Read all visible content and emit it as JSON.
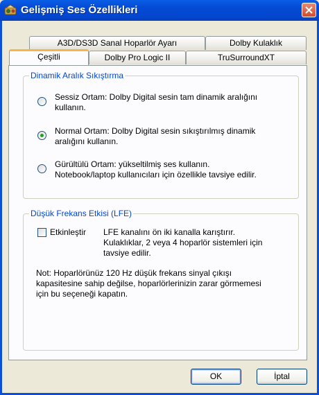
{
  "window": {
    "title": "Gelişmiş Ses Özellikleri"
  },
  "tabs": {
    "row_back": [
      "A3D/DS3D Sanal Hoparlör Ayarı",
      "Dolby Kulaklık"
    ],
    "row_front": [
      "Çeşitli",
      "Dolby Pro Logic II",
      "TruSurroundXT"
    ],
    "active": "Çeşitli"
  },
  "drc": {
    "legend": "Dinamik Aralık Sıkıştırma",
    "options": [
      {
        "line1": "Sessiz Ortam: Dolby Digital sesin tam dinamik aralığını",
        "line2": "kullanın.",
        "selected": false
      },
      {
        "line1": "Normal Ortam: Dolby Digital sesin sıkıştırılmış dinamik",
        "line2": "aralığını kullanın.",
        "selected": true
      },
      {
        "line1": "Gürültülü Ortam: yükseltilmiş ses kullanın.",
        "line2": "Notebook/laptop kullanıcıları için özellikle tavsiye edilir.",
        "selected": false
      }
    ]
  },
  "lfe": {
    "legend": "Düşük Frekans Etkisi (LFE)",
    "checkbox_label": "Etkinleştir",
    "checked": false,
    "desc1": "LFE kanalını ön iki kanalla karıştırır.",
    "desc2": "Kulaklıklar, 2 veya 4 hoparlör sistemleri için",
    "desc3": "tavsiye edilir.",
    "note1": "Not: Hoparlörünüz 120 Hz düşük frekans sinyal çıkışı",
    "note2": "kapasitesine sahip değilse, hoparlörlerinizin zarar görmemesi",
    "note3": "için bu seçeneği kapatın."
  },
  "buttons": {
    "ok": "OK",
    "cancel": "İptal"
  },
  "colors": {
    "titlebar": "#0449d4",
    "legend": "#0046d5",
    "radio_selected": "#21a121",
    "active_tab_accent": "#f7b547"
  }
}
